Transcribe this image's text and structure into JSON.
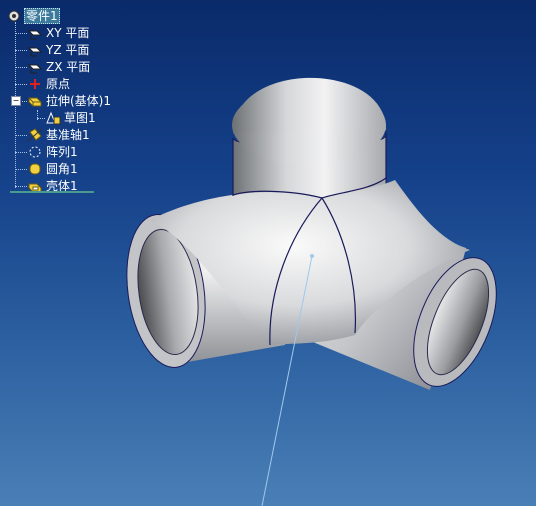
{
  "tree": {
    "root": {
      "label": "零件1",
      "icon": "part-icon"
    },
    "items": [
      {
        "label": "XY 平面",
        "icon": "plane-icon"
      },
      {
        "label": "YZ 平面",
        "icon": "plane-icon"
      },
      {
        "label": "ZX 平面",
        "icon": "plane-icon"
      },
      {
        "label": "原点",
        "icon": "origin-icon"
      },
      {
        "label": "拉伸(基体)1",
        "icon": "extrude-icon",
        "expanded": true,
        "children": [
          {
            "label": "草图1",
            "icon": "sketch-icon"
          }
        ]
      },
      {
        "label": "基准轴1",
        "icon": "datum-axis-icon"
      },
      {
        "label": "阵列1",
        "icon": "pattern-icon"
      },
      {
        "label": "圆角1",
        "icon": "fillet-icon"
      },
      {
        "label": "壳体1",
        "icon": "shell-icon"
      }
    ],
    "collapse_symbol": "−"
  },
  "viewport": {
    "model": "three-way pipe fitting",
    "colors": {
      "background_top": "#0a2a6a",
      "background_bottom": "#4a7fb6",
      "edge": "#1a1a5a",
      "axis": "#9fc8ec"
    }
  }
}
